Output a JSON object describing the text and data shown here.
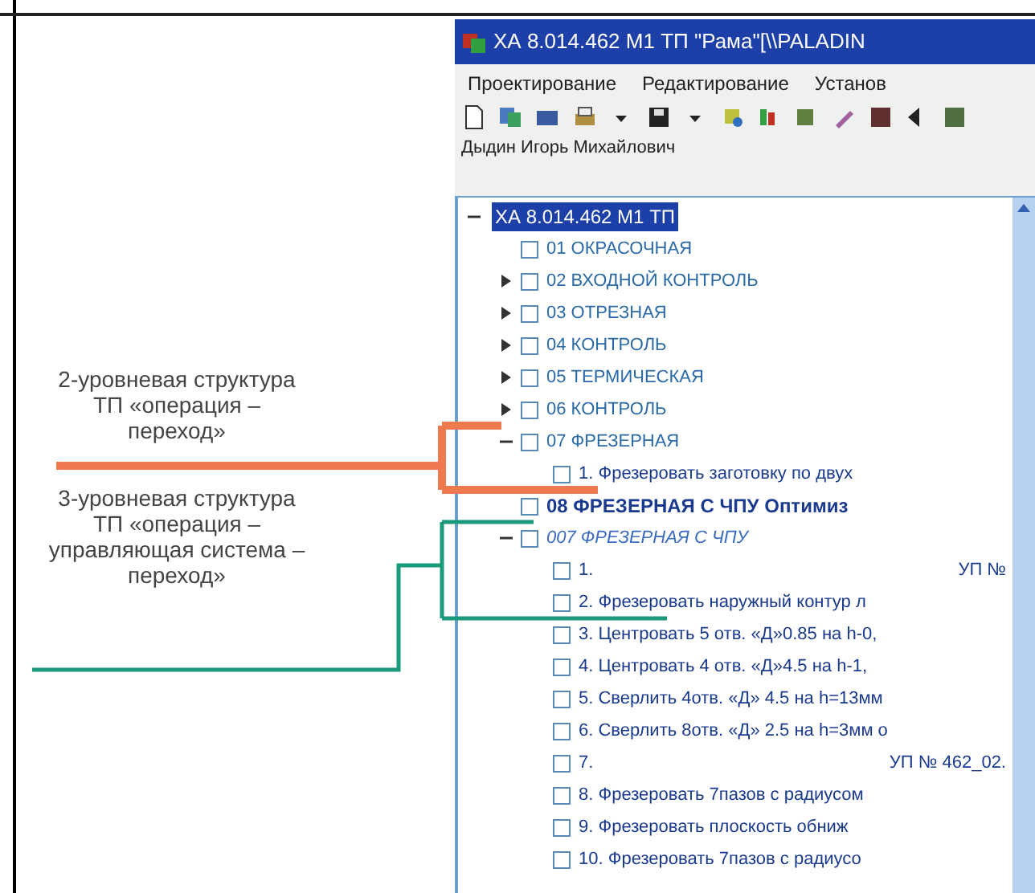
{
  "window": {
    "title": "ХА 8.014.462 М1 ТП \"Рама\"[\\\\PALADIN"
  },
  "menu": [
    "Проектирование",
    "Редактирование",
    "Установ"
  ],
  "user": "Дыдин Игорь Михайлович",
  "tree": {
    "label": "ХА 8.014.462 М1 ТП",
    "selected": true,
    "expanded": true,
    "children": [
      {
        "label": "01 ОКРАСОЧНАЯ",
        "kind": "operation",
        "checked": false
      },
      {
        "label": "02 ВХОДНОЙ КОНТРОЛЬ",
        "kind": "operation",
        "checked": false,
        "expanded": false
      },
      {
        "label": "03 ОТРЕЗНАЯ",
        "kind": "operation",
        "checked": false,
        "expanded": false
      },
      {
        "label": "04 КОНТРОЛЬ",
        "kind": "operation",
        "checked": false,
        "expanded": false
      },
      {
        "label": "05 ТЕРМИЧЕСКАЯ",
        "kind": "operation",
        "checked": false,
        "expanded": false
      },
      {
        "label": "06 КОНТРОЛЬ",
        "kind": "operation",
        "checked": false,
        "expanded": false
      },
      {
        "label": "07 ФРЕЗЕРНАЯ",
        "kind": "operation",
        "checked": false,
        "expanded": true,
        "children": [
          {
            "label": "1. Фрезеровать заготовку по двух",
            "kind": "step",
            "checked": false
          }
        ]
      },
      {
        "label": "08  ФРЕЗЕРНАЯ С ЧПУ   Оптимиз",
        "kind": "cnc_operation",
        "checked": false
      },
      {
        "label": "007 ФРЕЗЕРНАЯ С ЧПУ",
        "kind": "control_system",
        "checked": false,
        "expanded": true,
        "children": [
          {
            "label": "1.",
            "note": "УП №",
            "kind": "step",
            "checked": false
          },
          {
            "label": "2. Фрезеровать наружный контур л",
            "kind": "step",
            "checked": false
          },
          {
            "label": "3. Центровать 5 отв. «Д»0.85 на h-0,",
            "kind": "step",
            "checked": false
          },
          {
            "label": "4. Центровать 4 отв. «Д»4.5 на h-1,",
            "kind": "step",
            "checked": false
          },
          {
            "label": "5. Сверлить 4отв. «Д» 4.5 на h=13мм",
            "kind": "step",
            "checked": false
          },
          {
            "label": "6. Сверлить 8отв. «Д» 2.5 на h=3мм о",
            "kind": "step",
            "checked": false
          },
          {
            "label": "7.",
            "note": "УП № 462_02.",
            "kind": "step",
            "checked": false
          },
          {
            "label": "8. Фрезеровать 7пазов с радиусом",
            "kind": "step",
            "checked": false
          },
          {
            "label": "9. Фрезеровать плоскость обниж",
            "kind": "step",
            "checked": false
          },
          {
            "label": "10. Фрезеровать 7пазов с радиусо",
            "kind": "step",
            "checked": false
          }
        ]
      }
    ]
  },
  "annotations": [
    {
      "text": "2-уровневая структура ТП «операция – переход»",
      "color": "#f07a50"
    },
    {
      "text": "3-уровневая структура ТП «операция – управляющая система – переход»",
      "color": "#1a9a7a"
    }
  ]
}
